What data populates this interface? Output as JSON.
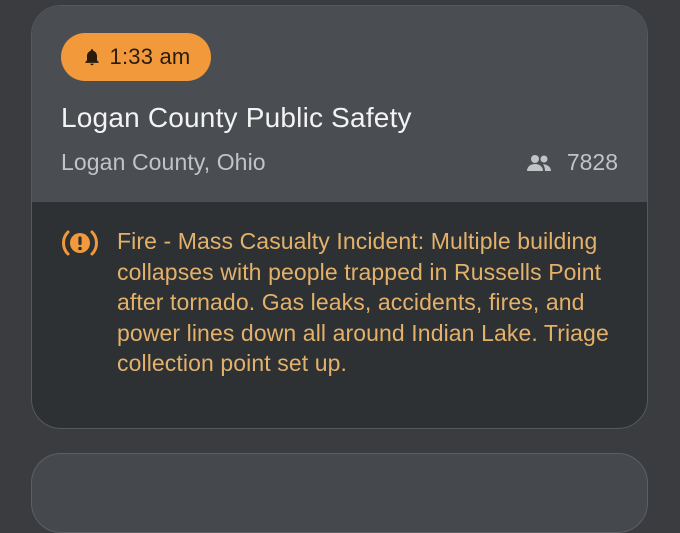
{
  "alert_card": {
    "time": "1:33 am",
    "agency": "Logan County Public Safety",
    "location": "Logan County, Ohio",
    "member_count": "7828",
    "message": "Fire - Mass Casualty Incident: Multiple building collapses with people trapped in Russells Point after tornado. Gas leaks, accidents, fires, and power lines down all around Indian Lake. Triage collection point set up."
  },
  "icons": {
    "time_badge": "bell-icon",
    "members": "group-icon",
    "alert": "warning-icon"
  },
  "colors": {
    "badge": "#f29a3b",
    "alert_text": "#e3b16a",
    "header_bg": "#4a4d51",
    "body_bg": "#2e3134"
  }
}
